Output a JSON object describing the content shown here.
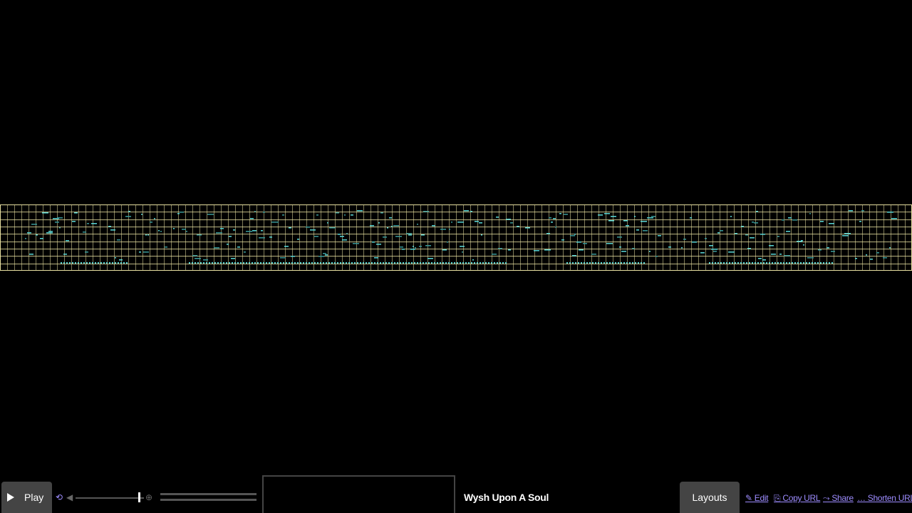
{
  "toolbar": {
    "play_label": "Play",
    "song_title": "Wysh Upon A Soul",
    "layouts_label": "Layouts",
    "links": {
      "edit": "✎ Edit",
      "copy_url": "⎘ Copy URL",
      "share": "⤳ Share",
      "shorten_url": "… Shorten URL"
    },
    "volume_level": 0.93
  },
  "colors": {
    "background": "#000000",
    "grid_line": "#e8e0a0",
    "note_primary": "#5ad8d8",
    "note_secondary": "#3a9a9a",
    "button_bg": "#444444",
    "link": "#9d8cff"
  }
}
